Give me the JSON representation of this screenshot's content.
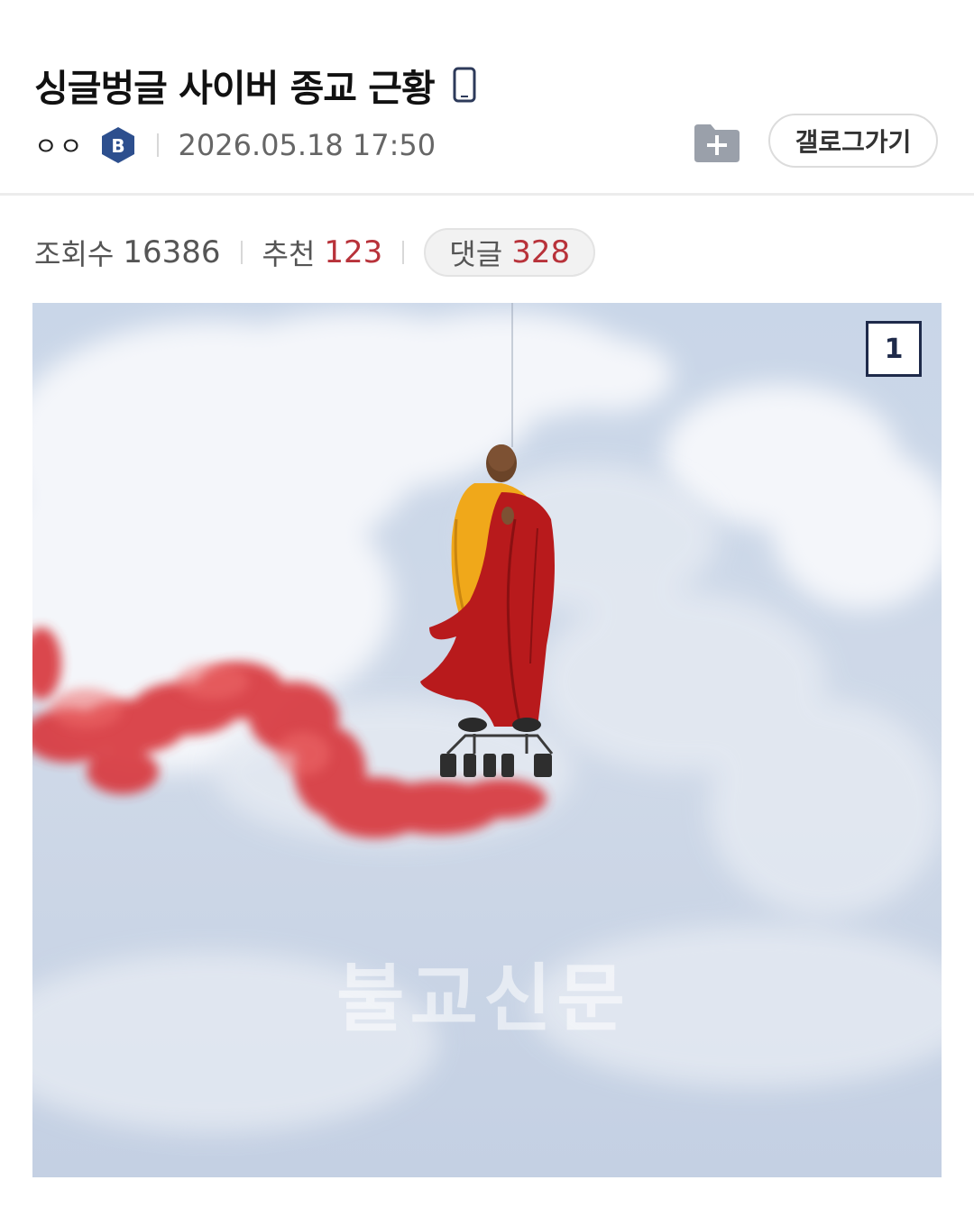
{
  "post": {
    "title": "싱글벙글 사이버 종교 근황",
    "author": "ㅇㅇ",
    "datetime": "2026.05.18 17:50"
  },
  "actions": {
    "gallery_button": "갤로그가기"
  },
  "stats": {
    "views_label": "조회수",
    "views": "16386",
    "recommend_label": "추천",
    "recommend": "123",
    "comments_label": "댓글",
    "comments": "328"
  },
  "image": {
    "watermark": "불교신문",
    "page_counter": "1"
  },
  "colors": {
    "accent_red": "#b8323a",
    "badge_blue": "#2d4f8e",
    "icon_navy": "#1e2a4a"
  },
  "icons": {
    "mobile": "mobile-phone-icon",
    "badge": "b-badge-icon",
    "folder": "folder-add-icon"
  }
}
